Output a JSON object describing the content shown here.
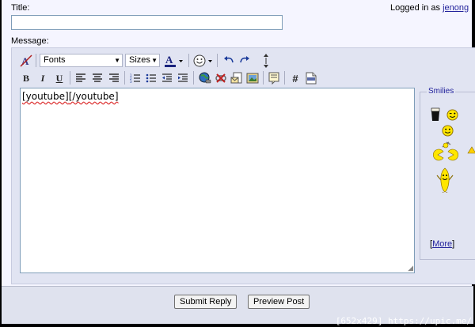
{
  "form": {
    "title_label": "Title:",
    "title_value": "",
    "logged_in_prefix": "Logged in as",
    "username": "jenong",
    "message_label": "Message:"
  },
  "toolbar": {
    "fonts_label": "Fonts",
    "sizes_label": "Sizes",
    "font_color_glyph": "A",
    "bold": "B",
    "italic": "I",
    "underline": "U",
    "hash": "#"
  },
  "editor": {
    "content_tag_open": "[youtube]",
    "content_tag_close": "[/youtube]"
  },
  "smilies": {
    "legend": "Smilies",
    "more_open": "[",
    "more_label": "More",
    "more_close": "]"
  },
  "buttons": {
    "submit": "Submit Reply",
    "preview": "Preview Post"
  },
  "watermark": "[652x429] https://upic.me/",
  "colors": {
    "page_bg": "#f5f5ff",
    "editor_bg": "#e1e4f2",
    "link": "#22229c"
  }
}
